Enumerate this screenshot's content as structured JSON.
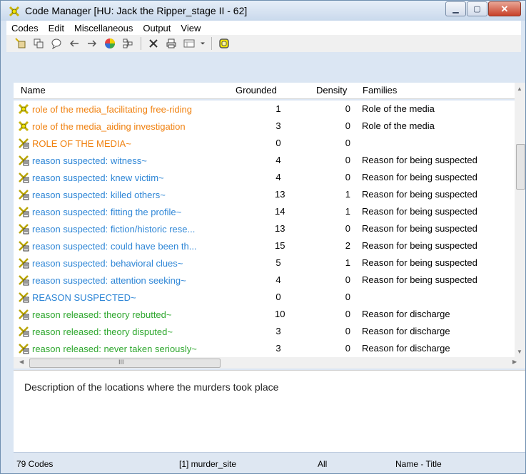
{
  "window": {
    "title": "Code Manager [HU: Jack the Ripper_stage II - 62]"
  },
  "menu": [
    "Codes",
    "Edit",
    "Miscellaneous",
    "Output",
    "View"
  ],
  "toolbar": [
    "new-code-icon",
    "copy-icon",
    "comment-icon",
    "arrow-left-icon",
    "arrow-right-icon",
    "color-icon",
    "tree-icon",
    "delete-icon",
    "print-icon",
    "view-icon",
    "dropdown-icon",
    "highlight-icon"
  ],
  "columns": {
    "name": "Name",
    "grounded": "Grounded",
    "density": "Density",
    "families": "Families"
  },
  "rows": [
    {
      "name": "role of the media_facilitating free-riding",
      "grounded": "1",
      "density": "0",
      "families": "Role of the media",
      "color": "#f0810f",
      "icon": "code-icon-plain"
    },
    {
      "name": "role of the media_aiding investigation",
      "grounded": "3",
      "density": "0",
      "families": "Role of the media",
      "color": "#f0810f",
      "icon": "code-icon-plain"
    },
    {
      "name": "ROLE OF THE MEDIA~",
      "grounded": "0",
      "density": "0",
      "families": "",
      "color": "#f0810f",
      "icon": "code-icon-comment"
    },
    {
      "name": "reason suspected: witness~",
      "grounded": "4",
      "density": "0",
      "families": "Reason for being suspected",
      "color": "#2e86d6",
      "icon": "code-icon-comment"
    },
    {
      "name": "reason suspected: knew victim~",
      "grounded": "4",
      "density": "0",
      "families": "Reason for being suspected",
      "color": "#2e86d6",
      "icon": "code-icon-comment"
    },
    {
      "name": "reason suspected: killed others~",
      "grounded": "13",
      "density": "1",
      "families": "Reason for being suspected",
      "color": "#2e86d6",
      "icon": "code-icon-comment"
    },
    {
      "name": "reason suspected: fitting the profile~",
      "grounded": "14",
      "density": "1",
      "families": "Reason for being suspected",
      "color": "#2e86d6",
      "icon": "code-icon-comment"
    },
    {
      "name": "reason suspected: fiction/historic rese...",
      "grounded": "13",
      "density": "0",
      "families": "Reason for being suspected",
      "color": "#2e86d6",
      "icon": "code-icon-comment"
    },
    {
      "name": "reason suspected: could have been th...",
      "grounded": "15",
      "density": "2",
      "families": "Reason for being suspected",
      "color": "#2e86d6",
      "icon": "code-icon-comment"
    },
    {
      "name": "reason suspected: behavioral clues~",
      "grounded": "5",
      "density": "1",
      "families": "Reason for being suspected",
      "color": "#2e86d6",
      "icon": "code-icon-comment"
    },
    {
      "name": "reason suspected: attention seeking~",
      "grounded": "4",
      "density": "0",
      "families": "Reason for being suspected",
      "color": "#2e86d6",
      "icon": "code-icon-comment"
    },
    {
      "name": "REASON SUSPECTED~",
      "grounded": "0",
      "density": "0",
      "families": "",
      "color": "#2e86d6",
      "icon": "code-icon-comment"
    },
    {
      "name": "reason released: theory rebutted~",
      "grounded": "10",
      "density": "0",
      "families": "Reason for discharge",
      "color": "#2fa72f",
      "icon": "code-icon-comment"
    },
    {
      "name": "reason released: theory disputed~",
      "grounded": "3",
      "density": "0",
      "families": "Reason for discharge",
      "color": "#2fa72f",
      "icon": "code-icon-comment"
    },
    {
      "name": "reason released: never taken seriously~",
      "grounded": "3",
      "density": "0",
      "families": "Reason for discharge",
      "color": "#2fa72f",
      "icon": "code-icon-comment"
    }
  ],
  "hscroll": {
    "grip": "III"
  },
  "description": "Description of the locations where the murders took place",
  "status": {
    "count": "79 Codes",
    "selected": "[1] murder_site",
    "filter": "All",
    "sort": "Name - Title"
  }
}
